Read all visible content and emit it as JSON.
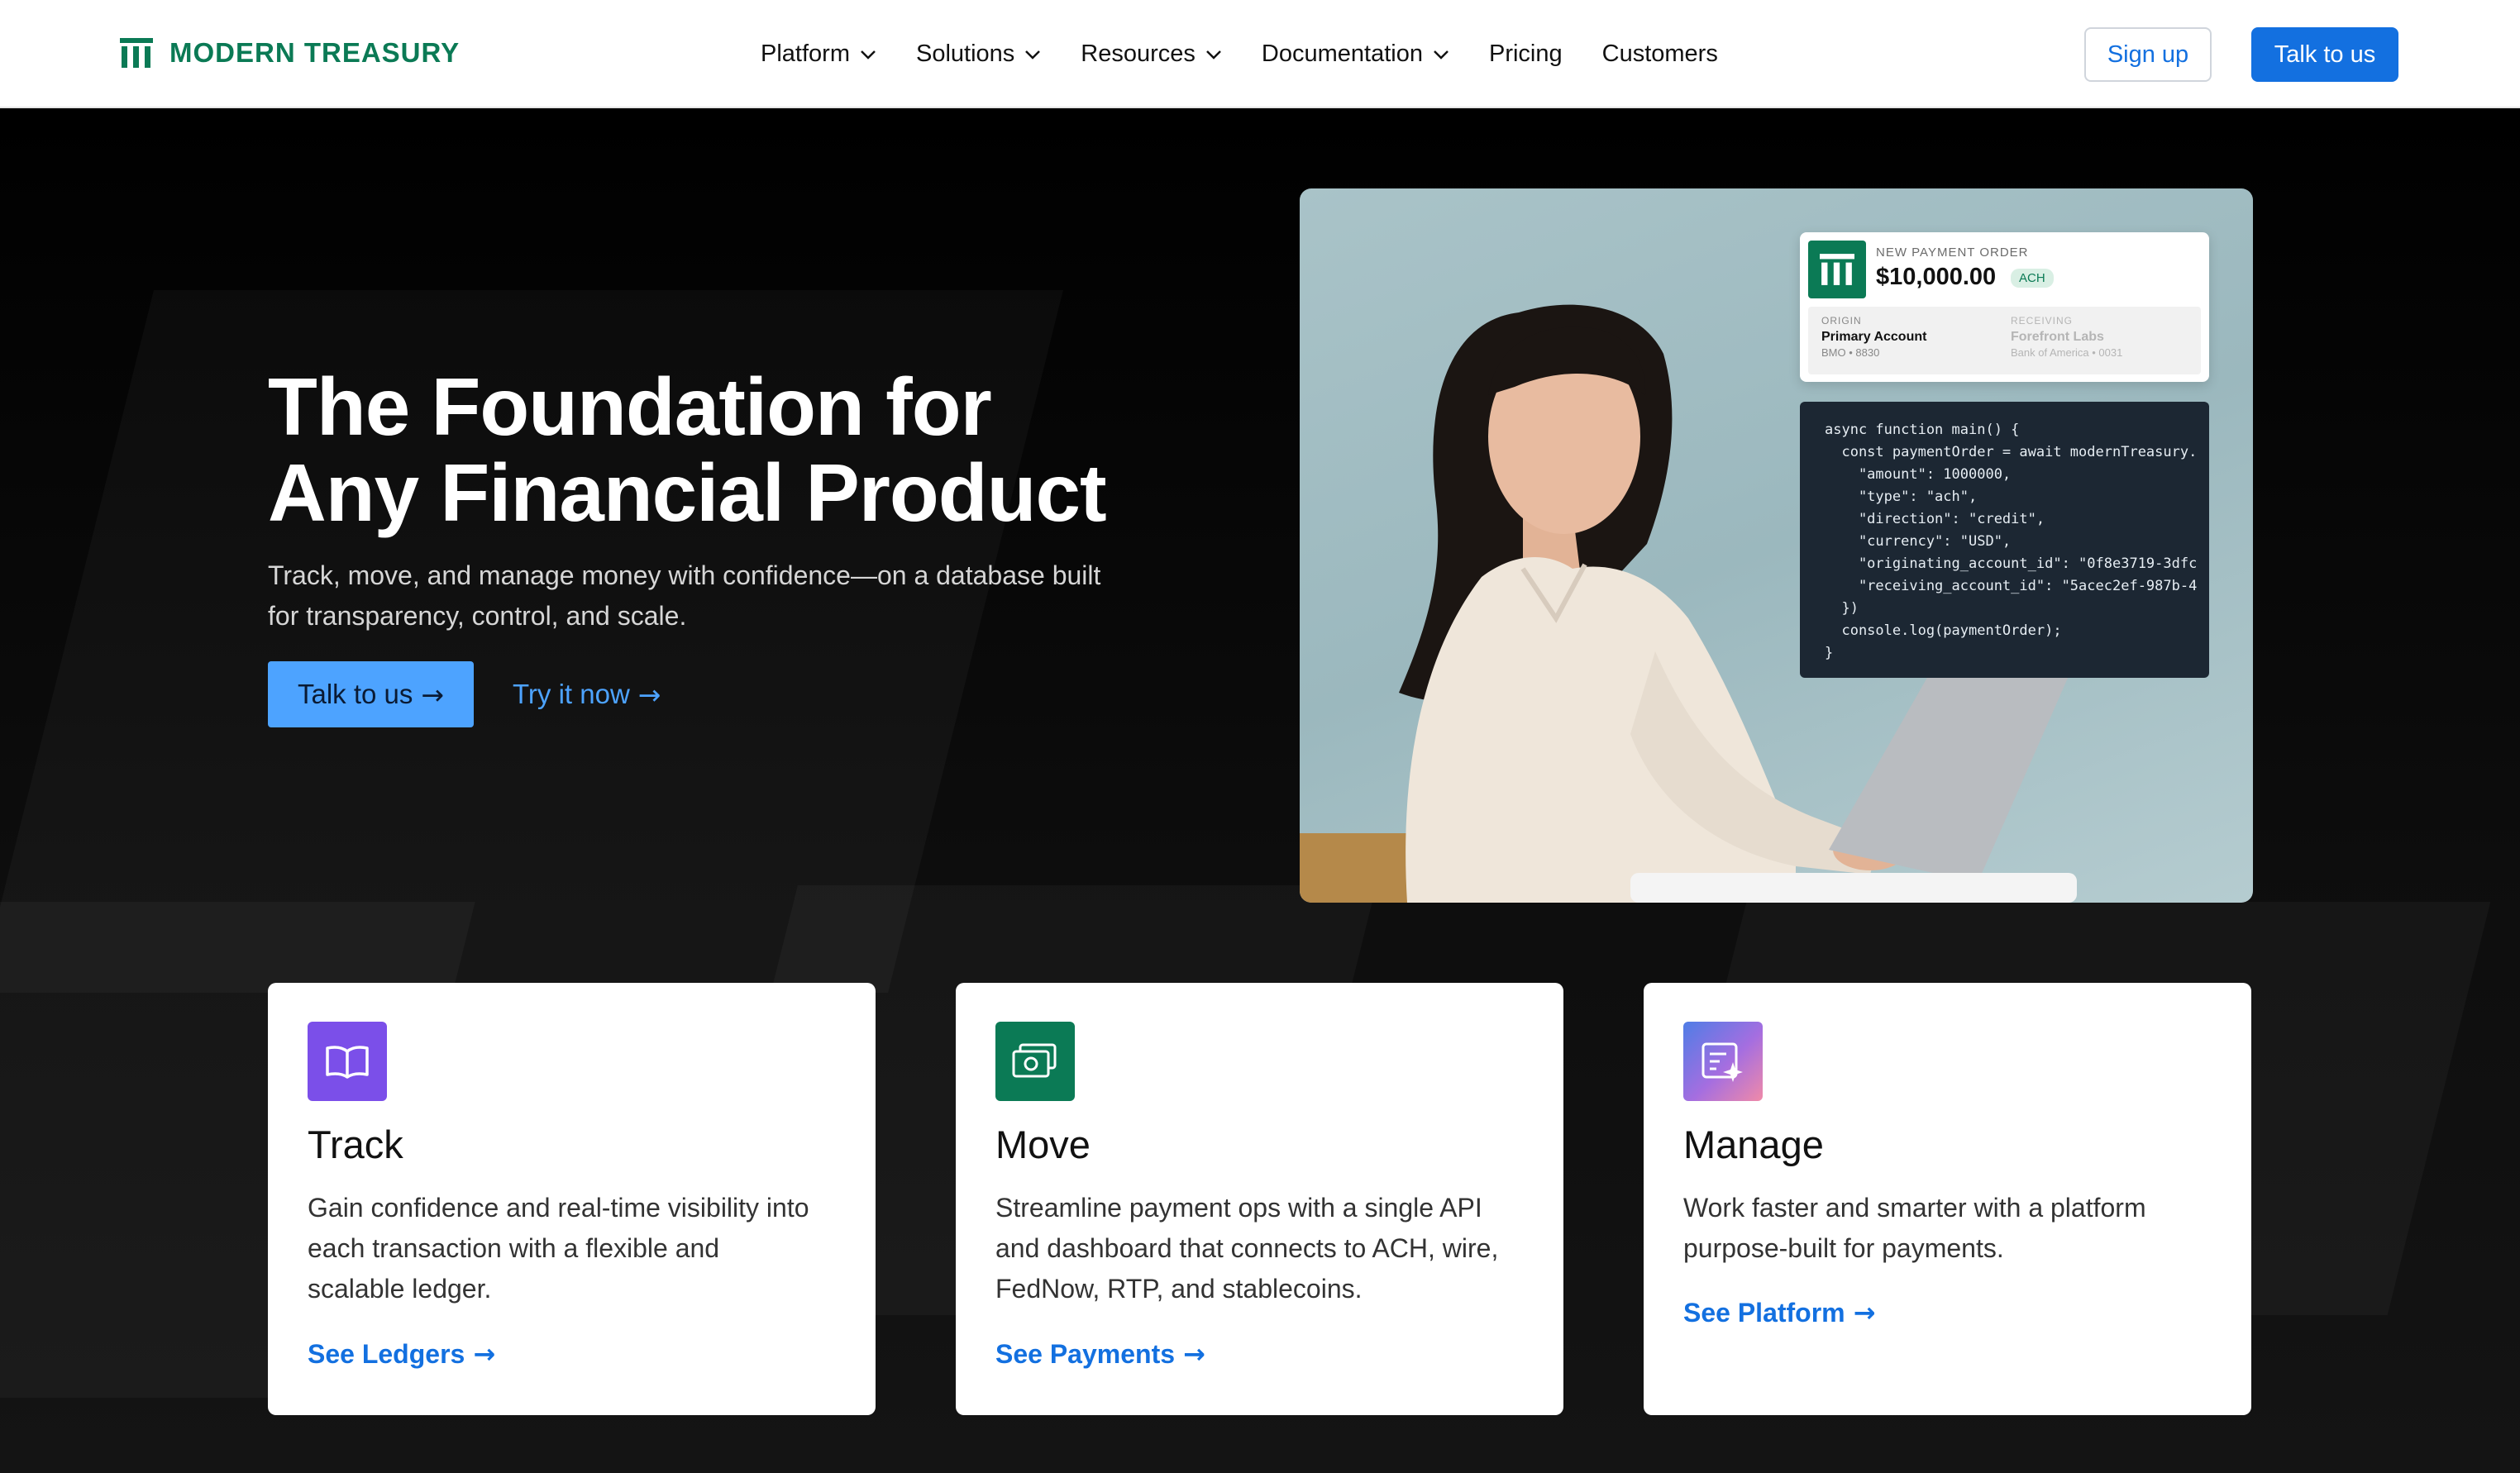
{
  "nav": {
    "logo_text": "MODERN TREASURY",
    "links": [
      {
        "label": "Platform",
        "has_dropdown": true
      },
      {
        "label": "Solutions",
        "has_dropdown": true
      },
      {
        "label": "Resources",
        "has_dropdown": true
      },
      {
        "label": "Documentation",
        "has_dropdown": true
      },
      {
        "label": "Pricing",
        "has_dropdown": false
      },
      {
        "label": "Customers",
        "has_dropdown": false
      }
    ],
    "signup_label": "Sign up",
    "talk_label": "Talk to us"
  },
  "hero": {
    "title_line1": "The Foundation for",
    "title_line2": "Any Financial Product",
    "subtitle": "Track, move, and manage money with confidence—on a database built for transparency, control, and scale.",
    "primary_cta": "Talk to us",
    "secondary_cta": "Try it now",
    "arrow": "→"
  },
  "payment_card": {
    "label": "NEW PAYMENT ORDER",
    "amount": "$10,000.00",
    "badge": "ACH",
    "origin_key": "ORIGIN",
    "origin_value": "Primary Account",
    "origin_detail": "BMO • 8830",
    "receiving_key": "RECEIVING",
    "receiving_value": "Forefront Labs",
    "receiving_detail": "Bank of America • 0031"
  },
  "code": [
    "async function main() {",
    "  const paymentOrder = await modernTreasury.",
    "    \"amount\": 1000000,",
    "    \"type\": \"ach\",",
    "    \"direction\": \"credit\",",
    "    \"currency\": \"USD\",",
    "    \"originating_account_id\": \"0f8e3719-3dfc",
    "    \"receiving_account_id\": \"5acec2ef-987b-4",
    "  })",
    "  console.log(paymentOrder);",
    "}"
  ],
  "cards": [
    {
      "icon": "book-icon",
      "title": "Track",
      "text": "Gain confidence and real-time visibility into each transaction with a flexible and scalable ledger.",
      "link": "See Ledgers",
      "color": "#7b4fe9"
    },
    {
      "icon": "money-icon",
      "title": "Move",
      "text": "Streamline payment ops with a single API and dashboard that connects to ACH, wire, FedNow, RTP, and stablecoins.",
      "link": "See Payments",
      "color": "#0b7a55"
    },
    {
      "icon": "sparkle-doc-icon",
      "title": "Manage",
      "text": "Work faster and smarter with a platform purpose-built for payments.",
      "link": "See Platform",
      "color": "#6d7fe6"
    }
  ],
  "colors": {
    "brand_green": "#0b7a55",
    "primary_blue": "#1370e0",
    "light_blue": "#4da3ff"
  }
}
